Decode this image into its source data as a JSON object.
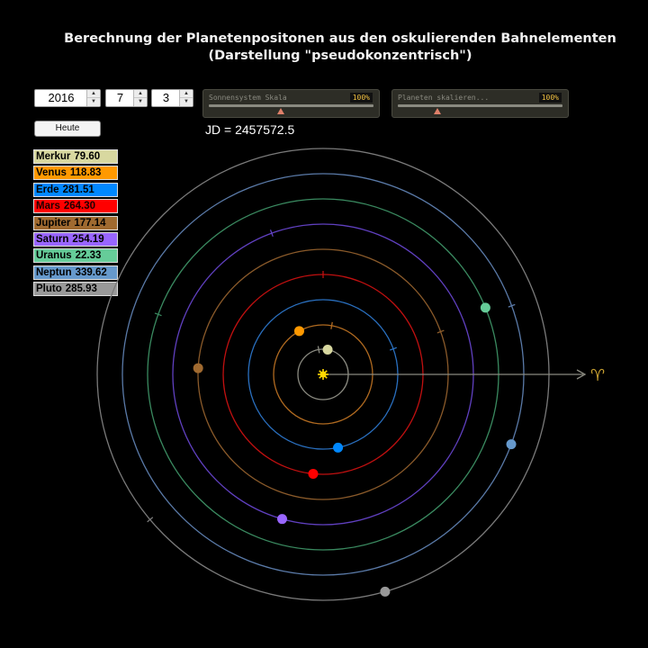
{
  "title": {
    "line1": "Berechnung der Planetenpositonen aus den oskulierenden Bahnelementen",
    "line2": "(Darstellung \"pseudokonzentrisch\")"
  },
  "date": {
    "year": "2016",
    "month": "7",
    "day": "3"
  },
  "today_button": "Heute",
  "sliders": [
    {
      "label": "Sonnensystem Skala",
      "value": "100%",
      "level": 0.45
    },
    {
      "label": "Planeten skalieren...",
      "value": "100%",
      "level": 0.25
    }
  ],
  "jd_text": "JD = 2457572.5",
  "aries_symbol": "♈",
  "sun_color": "#ffd800",
  "planets": [
    {
      "name": "Merkur",
      "value": "79.60",
      "color": "#d8d8a0",
      "text_color": "#000000",
      "angle": 79.6,
      "orbit": "#8a8a80"
    },
    {
      "name": "Venus",
      "value": "118.83",
      "color": "#ff9900",
      "text_color": "#000000",
      "angle": 118.83,
      "orbit": "#b06a20"
    },
    {
      "name": "Erde",
      "value": "281.51",
      "color": "#0088ff",
      "text_color": "#000000",
      "angle": 281.51,
      "orbit": "#2a70c0"
    },
    {
      "name": "Mars",
      "value": "264.30",
      "color": "#ff0000",
      "text_color": "#200000",
      "angle": 264.3,
      "orbit": "#c01010"
    },
    {
      "name": "Jupiter",
      "value": "177.14",
      "color": "#a06a30",
      "text_color": "#000000",
      "angle": 177.14,
      "orbit": "#8a5a2a"
    },
    {
      "name": "Saturn",
      "value": "254.19",
      "color": "#9966ff",
      "text_color": "#000000",
      "angle": 254.19,
      "orbit": "#6040c0"
    },
    {
      "name": "Uranus",
      "value": "22.33",
      "color": "#66cc99",
      "text_color": "#000000",
      "angle": 22.33,
      "orbit": "#3a8a60"
    },
    {
      "name": "Neptun",
      "value": "339.62",
      "color": "#6699cc",
      "text_color": "#000000",
      "angle": 339.62,
      "orbit": "#5a7aa8"
    },
    {
      "name": "Pluto",
      "value": "285.93",
      "color": "#999999",
      "text_color": "#000000",
      "angle": 285.93,
      "orbit": "#7a7a7a"
    }
  ]
}
